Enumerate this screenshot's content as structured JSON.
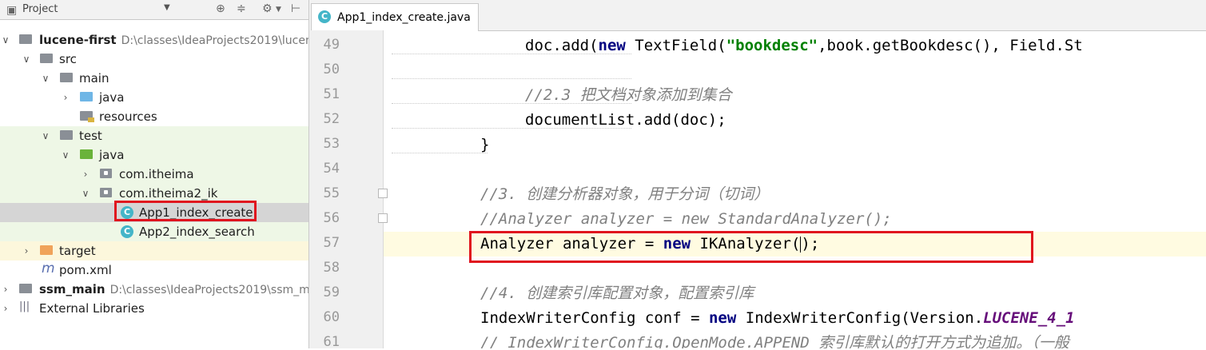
{
  "project_panel": {
    "title": "Project",
    "tree": [
      {
        "label": "lucene-first",
        "path": "D:\\classes\\IdeaProjects2019\\lucen"
      },
      {
        "label": "src"
      },
      {
        "label": "main"
      },
      {
        "label": "java"
      },
      {
        "label": "resources"
      },
      {
        "label": "test"
      },
      {
        "label": "java"
      },
      {
        "label": "com.itheima"
      },
      {
        "label": "com.itheima2_ik"
      },
      {
        "label": "App1_index_create"
      },
      {
        "label": "App2_index_search"
      },
      {
        "label": "target"
      },
      {
        "label": "pom.xml"
      },
      {
        "label": "ssm_main",
        "path": "D:\\classes\\IdeaProjects2019\\ssm_m"
      },
      {
        "label": "External Libraries"
      }
    ]
  },
  "editor": {
    "tab_label": "App1_index_create.java",
    "line_numbers": [
      "49",
      "50",
      "51",
      "52",
      "53",
      "54",
      "55",
      "56",
      "57",
      "58",
      "59",
      "60",
      "61"
    ],
    "code": {
      "l49_a": "doc.add(",
      "l49_kw": "new",
      "l49_b": " TextField(",
      "l49_str": "\"bookdesc\"",
      "l49_c": ",book.getBookdesc(), Field.St",
      "l51": "//2.3 把文档对象添加到集合",
      "l52": "documentList.add(doc);",
      "l53": "}",
      "l55": "//3. 创建分析器对象，用于分词（切词）",
      "l56": "//Analyzer analyzer = new StandardAnalyzer();",
      "l57_a": "Analyzer analyzer = ",
      "l57_kw": "new",
      "l57_b": " IKAnalyzer(",
      "l57_c": ");",
      "l59": "//4. 创建索引库配置对象，配置索引库",
      "l60_a": "IndexWriterConfig conf = ",
      "l60_kw": "new",
      "l60_b": " IndexWriterConfig(Version.",
      "l60_const": "LUCENE_4_1",
      "l61": "// IndexWriterConfig.OpenMode.APPEND 索引库默认的打开方式为追加。（一般"
    }
  },
  "colors": {
    "highlight_box": "#e0141e",
    "keyword": "#000080",
    "string": "#008000",
    "comment": "#808080",
    "constant": "#660e7a"
  }
}
